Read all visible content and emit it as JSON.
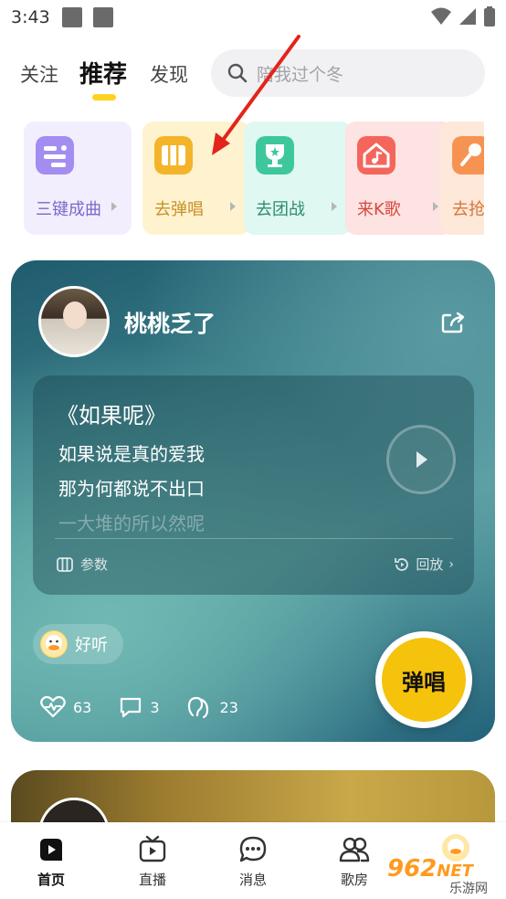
{
  "status_bar": {
    "time": "3:43"
  },
  "top_tabs": [
    {
      "label": "关注"
    },
    {
      "label": "推荐"
    },
    {
      "label": "发现"
    }
  ],
  "search": {
    "placeholder": "陪我过个冬"
  },
  "quick_entries": [
    {
      "label": "三键成曲",
      "color": "#7b68c9",
      "bg": "#f3eefe",
      "icon": "sparkle-grid-icon"
    },
    {
      "label": "去弹唱",
      "color": "#c8902a",
      "bg": "#fff3cf",
      "icon": "piano-keys-icon"
    },
    {
      "label": "去团战",
      "color": "#2e8c71",
      "bg": "#dff8f1",
      "icon": "trophy-icon"
    },
    {
      "label": "来K歌",
      "color": "#d6483f",
      "bg": "#fde3e1",
      "icon": "home-note-icon"
    },
    {
      "label": "去抢",
      "color": "#d6783a",
      "bg": "#fde8da",
      "icon": "mic-icon"
    }
  ],
  "post": {
    "username": "桃桃乏了",
    "song_title": "《如果呢》",
    "lyrics": [
      "如果说是真的爱我",
      "那为何都说不出口",
      "一大堆的所以然呢"
    ],
    "param_label": "参数",
    "replay_label": "回放",
    "tag": "好听",
    "likes": "63",
    "comments": "3",
    "listens": "23",
    "sing_label": "弹唱"
  },
  "bottom_nav": [
    {
      "label": "首页",
      "icon": "home-play-icon"
    },
    {
      "label": "直播",
      "icon": "tv-icon"
    },
    {
      "label": "消息",
      "icon": "chat-icon"
    },
    {
      "label": "歌房",
      "icon": "people-icon"
    }
  ],
  "watermark": {
    "text": "962",
    "suffix": "NET",
    "sub": "乐游网"
  }
}
